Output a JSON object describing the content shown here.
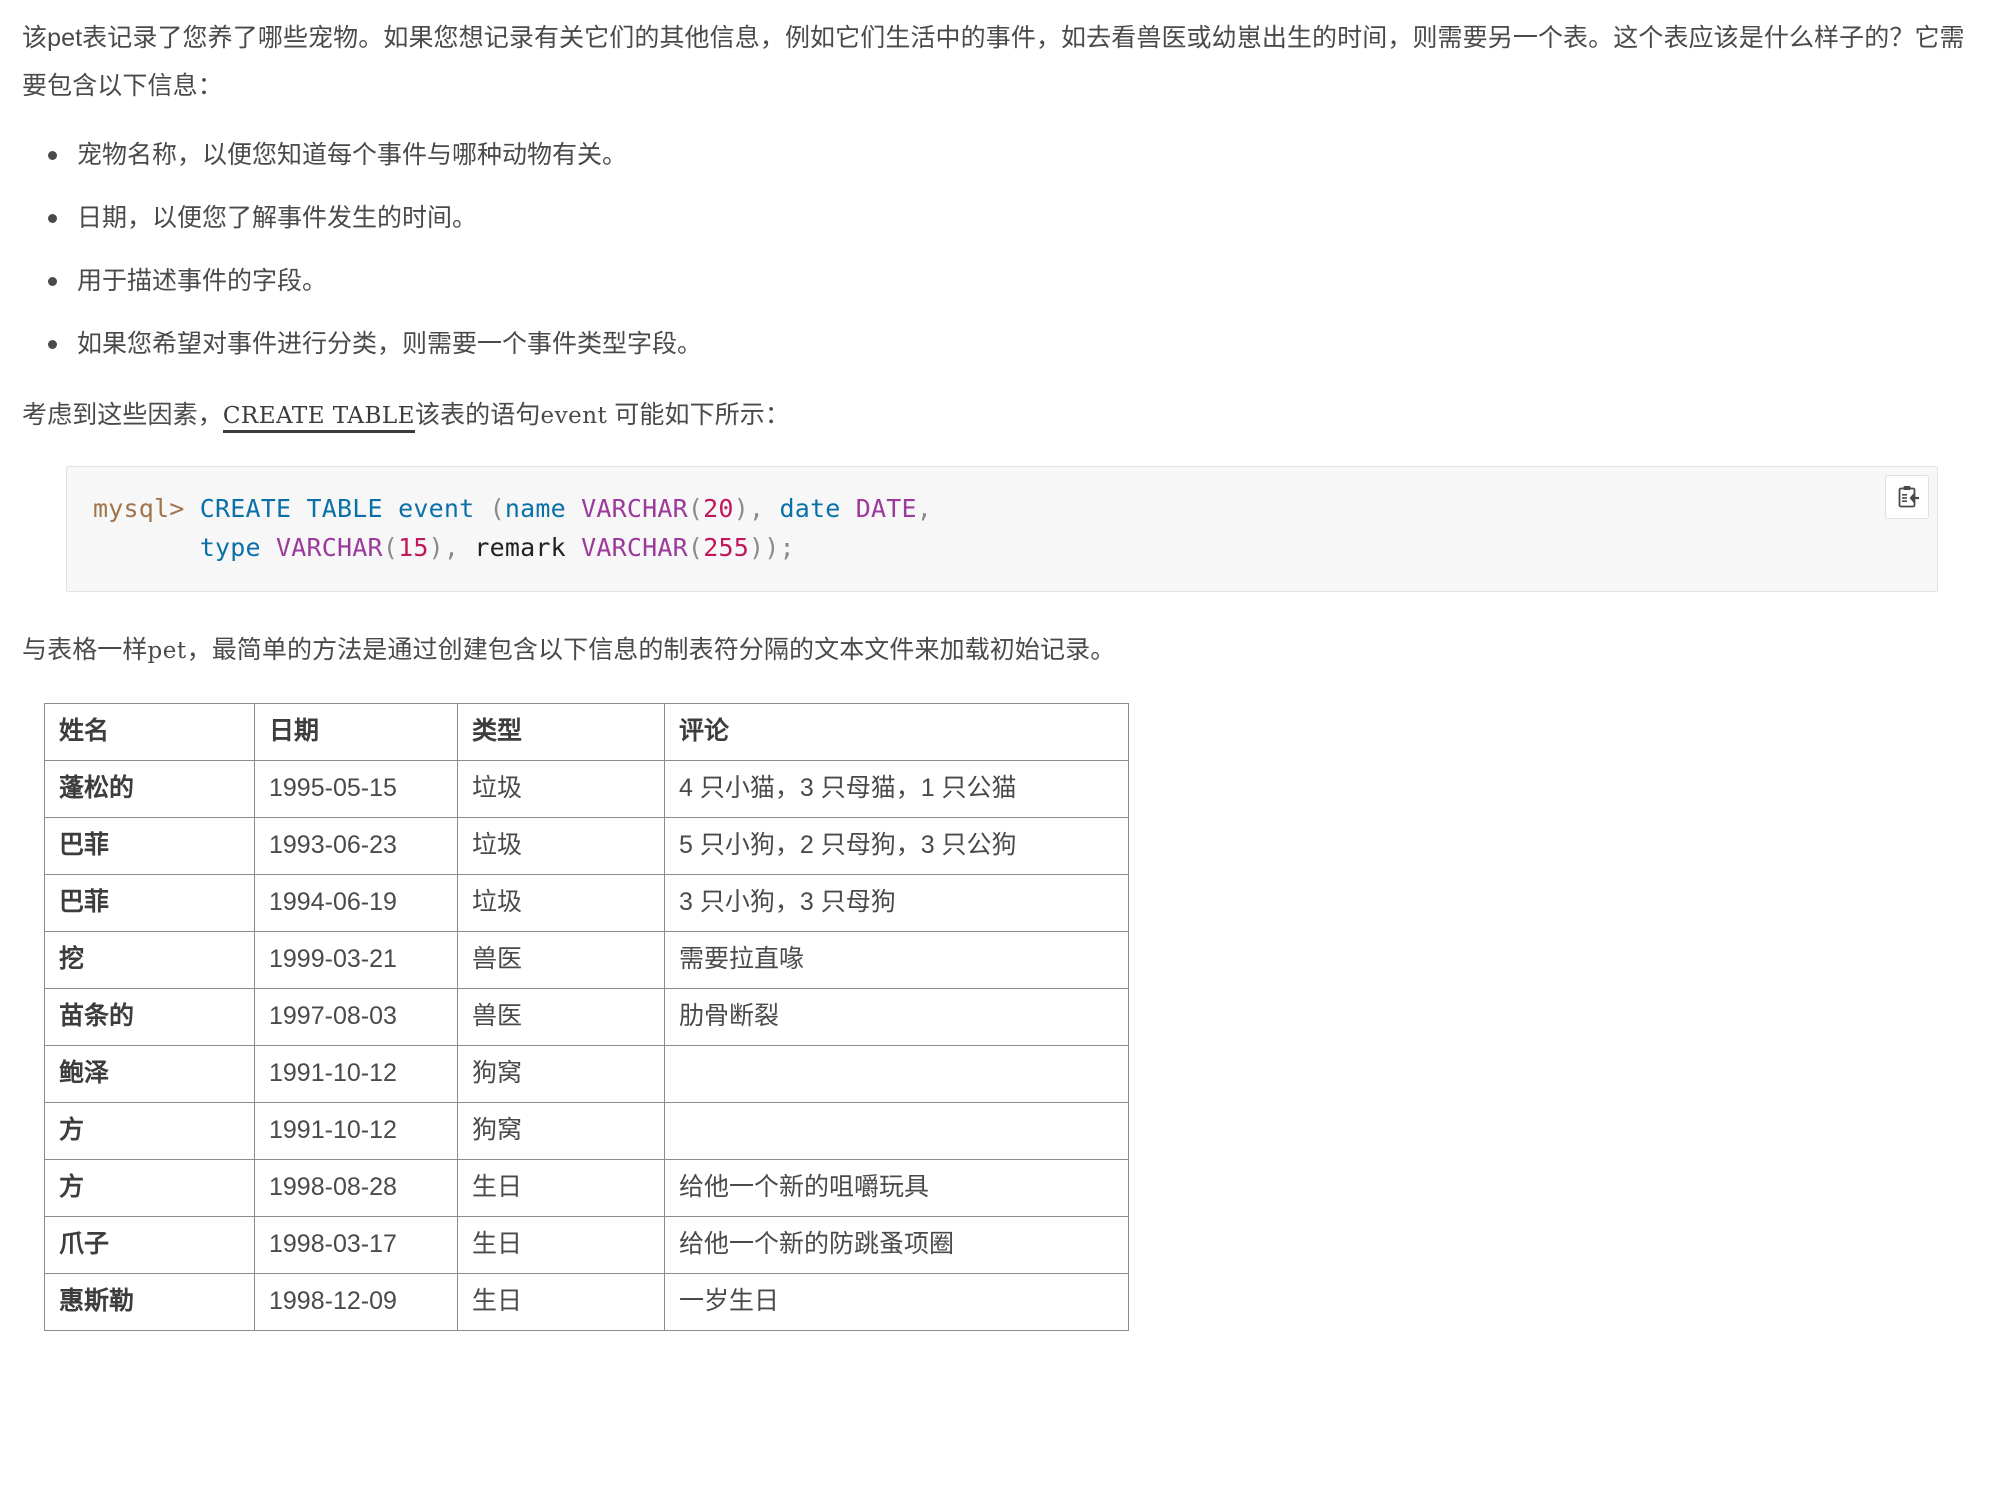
{
  "intro": {
    "paragraph": "该pet表记录了您养了哪些宠物。如果您想记录有关它们的其他信息，例如它们生活中的事件，如去看兽医或幼崽出生的时间，则需要另一个表。这个表应该是什么样子的？它需要包含以下信息："
  },
  "requirements": {
    "items": [
      "宠物名称，以便您知道每个事件与哪种动物有关。",
      "日期，以便您了解事件发生的时间。",
      "用于描述事件的字段。",
      "如果您希望对事件进行分类，则需要一个事件类型字段。"
    ]
  },
  "create_intro": {
    "before": "考虑到这些因素，",
    "code": "CREATE TABLE",
    "middle": "该表的语句",
    "code2": "event",
    "after": " 可能如下所示："
  },
  "codeblock": {
    "copy_label": "复制",
    "line1": {
      "prompt": "mysql>",
      "kw": "CREATE TABLE",
      "ident": "event",
      "paren_open": "(",
      "col1": "name",
      "type1": "VARCHAR",
      "size1": "20",
      "after1": "),",
      "col2": "date",
      "type2": "DATE",
      "comma": ","
    },
    "line2": {
      "col3": "type",
      "type3": "VARCHAR",
      "size3": "15",
      "after3": "),",
      "col4": "remark",
      "type4": "VARCHAR",
      "size4": "255",
      "tail": "));"
    },
    "full_text": "mysql> CREATE TABLE event (name VARCHAR(20), date DATE,\n       type VARCHAR(15), remark VARCHAR(255));"
  },
  "load_intro": {
    "before": "与表格一样",
    "code": "pet",
    "after": "，最简单的方法是通过创建包含以下信息的制表符分隔的文本文件来加载初始记录。"
  },
  "table": {
    "headers": [
      "姓名",
      "日期",
      "类型",
      "评论"
    ],
    "rows": [
      {
        "name": "蓬松的",
        "date": "1995-05-15",
        "type": "垃圾",
        "remark": "4 只小猫，3 只母猫，1 只公猫"
      },
      {
        "name": "巴菲",
        "date": "1993-06-23",
        "type": "垃圾",
        "remark": "5 只小狗，2 只母狗，3 只公狗"
      },
      {
        "name": "巴菲",
        "date": "1994-06-19",
        "type": "垃圾",
        "remark": "3 只小狗，3 只母狗"
      },
      {
        "name": "挖",
        "date": "1999-03-21",
        "type": "兽医",
        "remark": "需要拉直喙"
      },
      {
        "name": "苗条的",
        "date": "1997-08-03",
        "type": "兽医",
        "remark": "肋骨断裂"
      },
      {
        "name": "鲍泽",
        "date": "1991-10-12",
        "type": "狗窝",
        "remark": ""
      },
      {
        "name": "方",
        "date": "1991-10-12",
        "type": "狗窝",
        "remark": ""
      },
      {
        "name": "方",
        "date": "1998-08-28",
        "type": "生日",
        "remark": "给他一个新的咀嚼玩具"
      },
      {
        "name": "爪子",
        "date": "1998-03-17",
        "type": "生日",
        "remark": "给他一个新的防跳蚤项圈"
      },
      {
        "name": "惠斯勒",
        "date": "1998-12-09",
        "type": "生日",
        "remark": "一岁生日"
      }
    ]
  },
  "colors": {
    "text": "#4a4a4a",
    "code_bg": "#f7f7f8",
    "code_border": "#e3e3e5",
    "prompt": "#a1744b",
    "keyword": "#0a71a8",
    "type": "#9b3a9b",
    "number": "#c2185b",
    "punctuation": "#8a8a8a",
    "table_border": "#8a8d90"
  }
}
